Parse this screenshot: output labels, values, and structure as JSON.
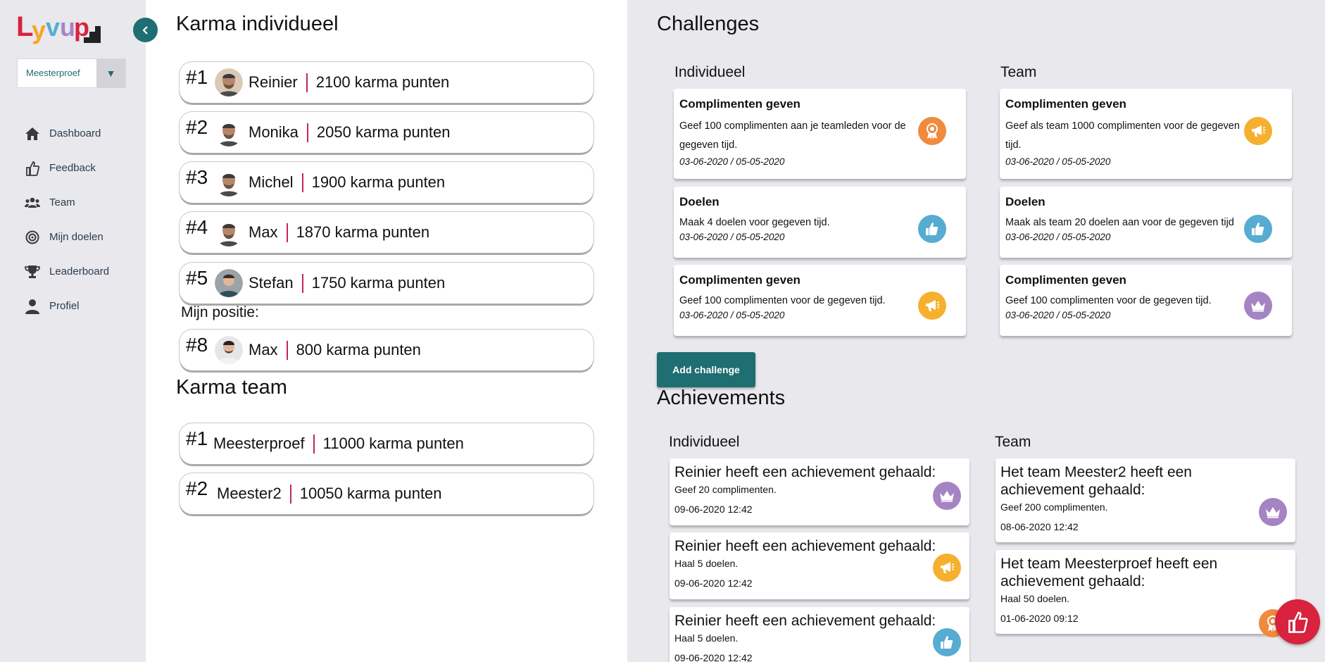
{
  "sidebar": {
    "logo_text": "Lyvup",
    "team_select": {
      "value": "Meesterproef",
      "arrow": "▼"
    },
    "nav": [
      {
        "label": "Dashboard",
        "icon": "home-icon"
      },
      {
        "label": "Feedback",
        "icon": "thumbs-up-icon"
      },
      {
        "label": "Team",
        "icon": "users-icon"
      },
      {
        "label": "Mijn doelen",
        "icon": "target-icon"
      },
      {
        "label": "Leaderboard",
        "icon": "trophy-icon"
      },
      {
        "label": "Profiel",
        "icon": "user-icon"
      }
    ]
  },
  "karma_individueel": {
    "title": "Karma individueel",
    "entries": [
      {
        "rank": "#1",
        "name": "Reinier",
        "points": "2100 karma punten"
      },
      {
        "rank": "#2",
        "name": "Monika",
        "points": "2050 karma punten"
      },
      {
        "rank": "#3",
        "name": "Michel",
        "points": "1900 karma punten"
      },
      {
        "rank": "#4",
        "name": "Max",
        "points": "1870 karma punten"
      },
      {
        "rank": "#5",
        "name": "Stefan",
        "points": "1750 karma punten"
      }
    ],
    "mijn_positie_label": "Mijn positie:",
    "mijn_positie": {
      "rank": "#8",
      "name": "Max",
      "points": "800 karma punten"
    }
  },
  "karma_team": {
    "title": "Karma team",
    "entries": [
      {
        "rank": "#1",
        "name": "Meesterproef",
        "points": "11000 karma punten"
      },
      {
        "rank": "#2",
        "name": "Meester2",
        "points": "10050 karma punten"
      }
    ]
  },
  "challenges": {
    "title": "Challenges",
    "individueel_label": "Individueel",
    "team_label": "Team",
    "individueel": [
      {
        "title": "Complimenten geven",
        "desc": "Geef 100 complimenten aan je teamleden voor de gegeven tijd.",
        "date": "03-06-2020 / 05-05-2020",
        "icon": "award-icon",
        "color": "#f08a3c"
      },
      {
        "title": "Doelen",
        "desc": "Maak 4 doelen voor gegeven tijd.",
        "date": "03-06-2020 / 05-05-2020",
        "icon": "thumbs-up-icon",
        "color": "#56acd1"
      },
      {
        "title": "Complimenten geven",
        "desc": "Geef 100 complimenten voor de gegeven tijd.",
        "date": "03-06-2020 / 05-05-2020",
        "icon": "megaphone-icon",
        "color": "#f5b02e"
      }
    ],
    "team": [
      {
        "title": "Complimenten geven",
        "desc": "Geef als team 1000 complimenten voor de gegeven tijd.",
        "date": "03-06-2020 / 05-05-2020",
        "icon": "megaphone-icon",
        "color": "#f5b02e"
      },
      {
        "title": "Doelen",
        "desc": "Maak als team 20 doelen aan voor de gegeven tijd",
        "date": "03-06-2020 / 05-05-2020",
        "icon": "thumbs-up-icon",
        "color": "#56acd1"
      },
      {
        "title": "Complimenten geven",
        "desc": "Geef 100 complimenten voor de gegeven tijd.",
        "date": "03-06-2020 / 05-05-2020",
        "icon": "crown-icon",
        "color": "#a584c4"
      }
    ],
    "add_button": "Add challenge"
  },
  "achievements": {
    "title": "Achievements",
    "individueel_label": "Individueel",
    "team_label": "Team",
    "individueel": [
      {
        "title": "Reinier heeft een achievement gehaald:",
        "desc": "Geef 20 complimenten.",
        "date": "09-06-2020 12:42",
        "icon": "crown-icon",
        "color": "#a584c4"
      },
      {
        "title": "Reinier heeft een achievement gehaald:",
        "desc": "Haal 5 doelen.",
        "date": "09-06-2020 12:42",
        "icon": "megaphone-icon",
        "color": "#f5b02e"
      },
      {
        "title": "Reinier heeft een achievement gehaald:",
        "desc": "Haal 5 doelen.",
        "date": "09-06-2020 12:42",
        "icon": "thumbs-up-icon",
        "color": "#56acd1"
      }
    ],
    "team": [
      {
        "title": "Het team Meester2 heeft een achievement gehaald:",
        "desc": "Geef 200 complimenten.",
        "date": "08-06-2020 12:42",
        "icon": "crown-icon",
        "color": "#a584c4"
      },
      {
        "title": "Het team Meesterproef heeft een achievement gehaald:",
        "desc": "Haal 50 doelen.",
        "date": "01-06-2020 09:12",
        "icon": "award-icon",
        "color": "#f08a3c"
      }
    ]
  },
  "colors": {
    "accent": "#1f6e71",
    "separator": "#c0275a",
    "fab": "#d8223e",
    "sidebar_bg": "#e9e8ed"
  }
}
